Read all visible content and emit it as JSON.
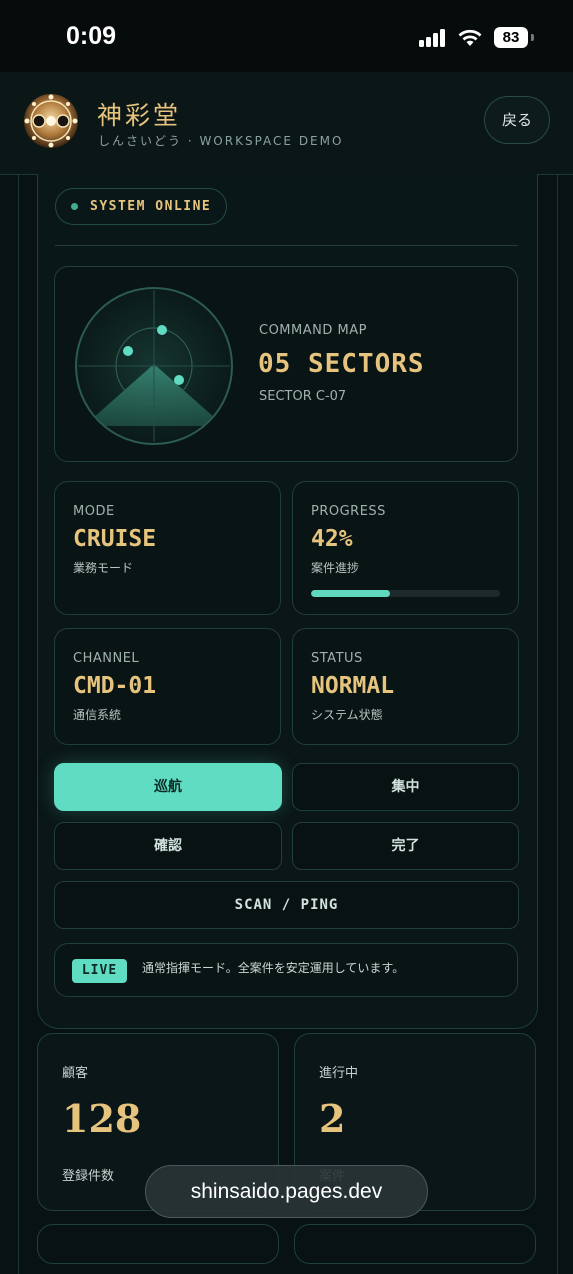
{
  "statusbar": {
    "time": "0:09",
    "battery": "83"
  },
  "header": {
    "title": "神彩堂",
    "subtitle": "しんさいどう · WORKSPACE DEMO",
    "back_label": "戻る"
  },
  "system_pill": {
    "label": "SYSTEM ONLINE"
  },
  "command_map": {
    "label": "COMMAND MAP",
    "value": "05 SECTORS",
    "sector": "SECTOR C-07"
  },
  "stats": [
    {
      "label": "MODE",
      "value": "CRUISE",
      "sub": "業務モード"
    },
    {
      "label": "PROGRESS",
      "value": "42%",
      "sub": "案件進捗",
      "progress": 0.42
    },
    {
      "label": "CHANNEL",
      "value": "CMD-01",
      "sub": "通信系統"
    },
    {
      "label": "STATUS",
      "value": "NORMAL",
      "sub": "システム状態"
    }
  ],
  "mode_buttons": [
    "巡航",
    "集中",
    "確認",
    "完了"
  ],
  "scan_button": "SCAN / PING",
  "live": {
    "badge": "LIVE",
    "message": "通常指揮モード。全案件を安定運用しています。"
  },
  "kpis": [
    {
      "label": "顧客",
      "value": "128",
      "sub": "登録件数"
    },
    {
      "label": "進行中",
      "value": "2",
      "sub": "案件"
    }
  ],
  "url_bar": {
    "text": "shinsaido.pages.dev"
  },
  "colors": {
    "accent": "#5fdcc2",
    "gold": "#e6c47d",
    "background": "#081213"
  }
}
